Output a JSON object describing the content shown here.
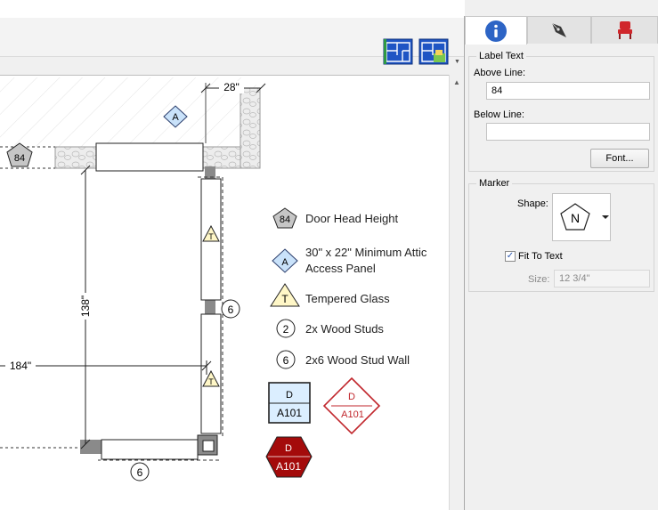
{
  "toolbar": {
    "icons": [
      "floor-plan-icon",
      "floor-plan-view-icon"
    ]
  },
  "tabs": [
    {
      "name": "info-icon",
      "active": true
    },
    {
      "name": "pen-icon",
      "active": false
    },
    {
      "name": "chair-icon",
      "active": false
    }
  ],
  "label_text": {
    "group_title": "Label Text",
    "above_line_label": "Above Line:",
    "above_line_value": "84",
    "below_line_label": "Below Line:",
    "below_line_value": "",
    "font_button": "Font..."
  },
  "marker": {
    "group_title": "Marker",
    "shape_label": "Shape:",
    "shape_letter": "N",
    "fit_to_text_label": "Fit To Text",
    "fit_to_text_checked": true,
    "size_label": "Size:",
    "size_value": "12 3/4\""
  },
  "drawing": {
    "dims": {
      "top": "28\"",
      "vertical": "138\"",
      "horizontal": "184\""
    },
    "markers": {
      "wall_84": "84",
      "attic": "A",
      "glass_1": "T",
      "glass_2": "T",
      "wall_6_a": "6",
      "wall_6_b": "6"
    },
    "legend": [
      {
        "symbol": "84",
        "text_lines": [
          "Door Head Height"
        ]
      },
      {
        "symbol": "A",
        "text_lines": [
          "30\" x 22\" Minimum Attic",
          "Access Panel"
        ]
      },
      {
        "symbol": "T",
        "text_lines": [
          "Tempered Glass"
        ]
      },
      {
        "symbol": "2",
        "text_lines": [
          "2x Wood Studs"
        ]
      },
      {
        "symbol": "6",
        "text_lines": [
          "2x6 Wood Stud Wall"
        ]
      }
    ],
    "callouts": [
      {
        "top": "D",
        "bottom": "A101",
        "style": "box-blue"
      },
      {
        "top": "D",
        "bottom": "A101",
        "style": "diamond-red"
      },
      {
        "top": "D",
        "bottom": "A101",
        "style": "hexagon-red"
      }
    ]
  },
  "colors": {
    "accent": "#2d64c5",
    "diamond_red": "#c1272d",
    "hex_fill": "#a40b0b",
    "legend_blue": "#dbeeff",
    "tri_yellow": "#fff7c7"
  }
}
